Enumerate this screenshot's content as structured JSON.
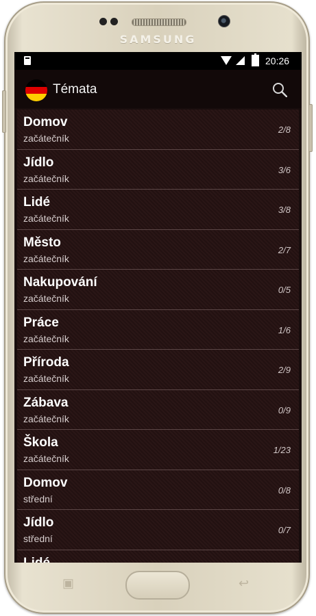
{
  "device": {
    "brand": "SAMSUNG"
  },
  "status_bar": {
    "time": "20:26"
  },
  "app_bar": {
    "title": "Témata",
    "flag_colors": [
      "#000000",
      "#dd0000",
      "#ffce00"
    ]
  },
  "topics": [
    {
      "name": "Domov",
      "level": "začátečník",
      "progress": "2/8"
    },
    {
      "name": "Jídlo",
      "level": "začátečník",
      "progress": "3/6"
    },
    {
      "name": "Lidé",
      "level": "začátečník",
      "progress": "3/8"
    },
    {
      "name": "Město",
      "level": "začátečník",
      "progress": "2/7"
    },
    {
      "name": "Nakupování",
      "level": "začátečník",
      "progress": "0/5"
    },
    {
      "name": "Práce",
      "level": "začátečník",
      "progress": "1/6"
    },
    {
      "name": "Příroda",
      "level": "začátečník",
      "progress": "2/9"
    },
    {
      "name": "Zábava",
      "level": "začátečník",
      "progress": "0/9"
    },
    {
      "name": "Škola",
      "level": "začátečník",
      "progress": "1/23"
    },
    {
      "name": "Domov",
      "level": "střední",
      "progress": "0/8"
    },
    {
      "name": "Jídlo",
      "level": "střední",
      "progress": "0/7"
    },
    {
      "name": "Lidé"
    }
  ]
}
